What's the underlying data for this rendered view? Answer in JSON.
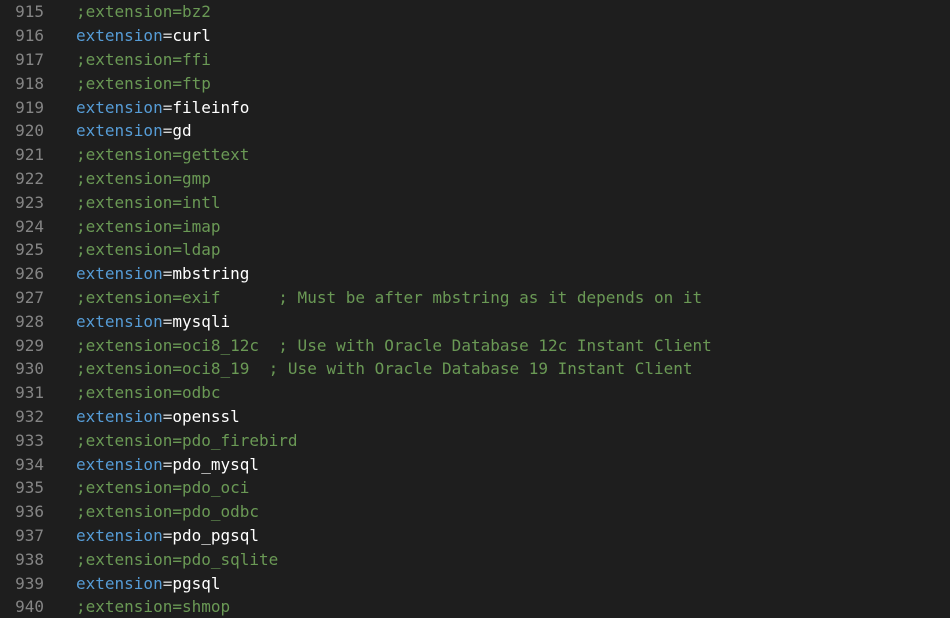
{
  "editor": {
    "lines": [
      {
        "number": "915",
        "kind": "comment",
        "text": ";extension=bz2"
      },
      {
        "number": "916",
        "kind": "setting",
        "key": "extension",
        "value": "curl"
      },
      {
        "number": "917",
        "kind": "comment",
        "text": ";extension=ffi"
      },
      {
        "number": "918",
        "kind": "comment",
        "text": ";extension=ftp"
      },
      {
        "number": "919",
        "kind": "setting",
        "key": "extension",
        "value": "fileinfo"
      },
      {
        "number": "920",
        "kind": "setting",
        "key": "extension",
        "value": "gd"
      },
      {
        "number": "921",
        "kind": "comment",
        "text": ";extension=gettext"
      },
      {
        "number": "922",
        "kind": "comment",
        "text": ";extension=gmp"
      },
      {
        "number": "923",
        "kind": "comment",
        "text": ";extension=intl"
      },
      {
        "number": "924",
        "kind": "comment",
        "text": ";extension=imap"
      },
      {
        "number": "925",
        "kind": "comment",
        "text": ";extension=ldap"
      },
      {
        "number": "926",
        "kind": "setting",
        "key": "extension",
        "value": "mbstring"
      },
      {
        "number": "927",
        "kind": "comment",
        "text": ";extension=exif      ; Must be after mbstring as it depends on it"
      },
      {
        "number": "928",
        "kind": "setting",
        "key": "extension",
        "value": "mysqli"
      },
      {
        "number": "929",
        "kind": "comment",
        "text": ";extension=oci8_12c  ; Use with Oracle Database 12c Instant Client"
      },
      {
        "number": "930",
        "kind": "comment",
        "text": ";extension=oci8_19  ; Use with Oracle Database 19 Instant Client"
      },
      {
        "number": "931",
        "kind": "comment",
        "text": ";extension=odbc"
      },
      {
        "number": "932",
        "kind": "setting",
        "key": "extension",
        "value": "openssl"
      },
      {
        "number": "933",
        "kind": "comment",
        "text": ";extension=pdo_firebird"
      },
      {
        "number": "934",
        "kind": "setting",
        "key": "extension",
        "value": "pdo_mysql"
      },
      {
        "number": "935",
        "kind": "comment",
        "text": ";extension=pdo_oci"
      },
      {
        "number": "936",
        "kind": "comment",
        "text": ";extension=pdo_odbc"
      },
      {
        "number": "937",
        "kind": "setting",
        "key": "extension",
        "value": "pdo_pgsql"
      },
      {
        "number": "938",
        "kind": "comment",
        "text": ";extension=pdo_sqlite"
      },
      {
        "number": "939",
        "kind": "setting",
        "key": "extension",
        "value": "pgsql"
      },
      {
        "number": "940",
        "kind": "comment",
        "text": ";extension=shmop"
      }
    ]
  },
  "theme": {
    "background": "#1e1e1e",
    "line_number": "#858585",
    "comment": "#6a9955",
    "keyword": "#569cd6",
    "text": "#ffffff"
  }
}
